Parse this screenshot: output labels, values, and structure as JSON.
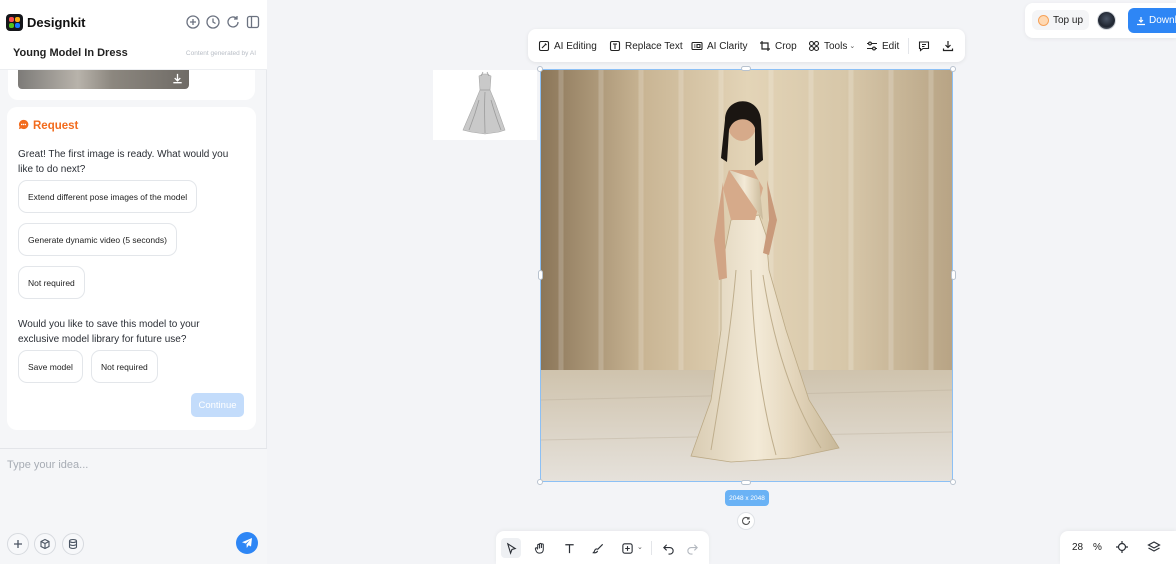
{
  "app": {
    "brand": "Designkit",
    "logo_colors": [
      "#ff4d4f",
      "#faad14",
      "#52c41a",
      "#1677ff"
    ]
  },
  "sidebar": {
    "project_title": "Young Model In Dress",
    "generated_note": "Content generated by AI",
    "header_icons": [
      "new-chat-icon",
      "history-icon",
      "refresh-icon",
      "collapse-panel-icon"
    ],
    "request": {
      "label": "Request",
      "message_1": "Great! The first image is ready. What would you like to do next?",
      "options_1": [
        "Extend different pose images of the model",
        "Generate dynamic video (5 seconds)",
        "Not required"
      ],
      "message_2": "Would you like to save this model to your exclusive model library for future use?",
      "options_2": [
        "Save model",
        "Not required"
      ],
      "continue_label": "Continue"
    },
    "input": {
      "placeholder": "Type your idea..."
    }
  },
  "toolbar": {
    "items": [
      "AI Editing",
      "Replace Text",
      "AI Clarity",
      "Crop",
      "Tools",
      "Edit"
    ]
  },
  "topbar": {
    "topup_label": "Top up",
    "download_label": "Download"
  },
  "canvas": {
    "image_dimensions": "2048 x 2048",
    "zoom_value": "28",
    "zoom_unit": "%",
    "accent_color": "#2e86f5"
  }
}
